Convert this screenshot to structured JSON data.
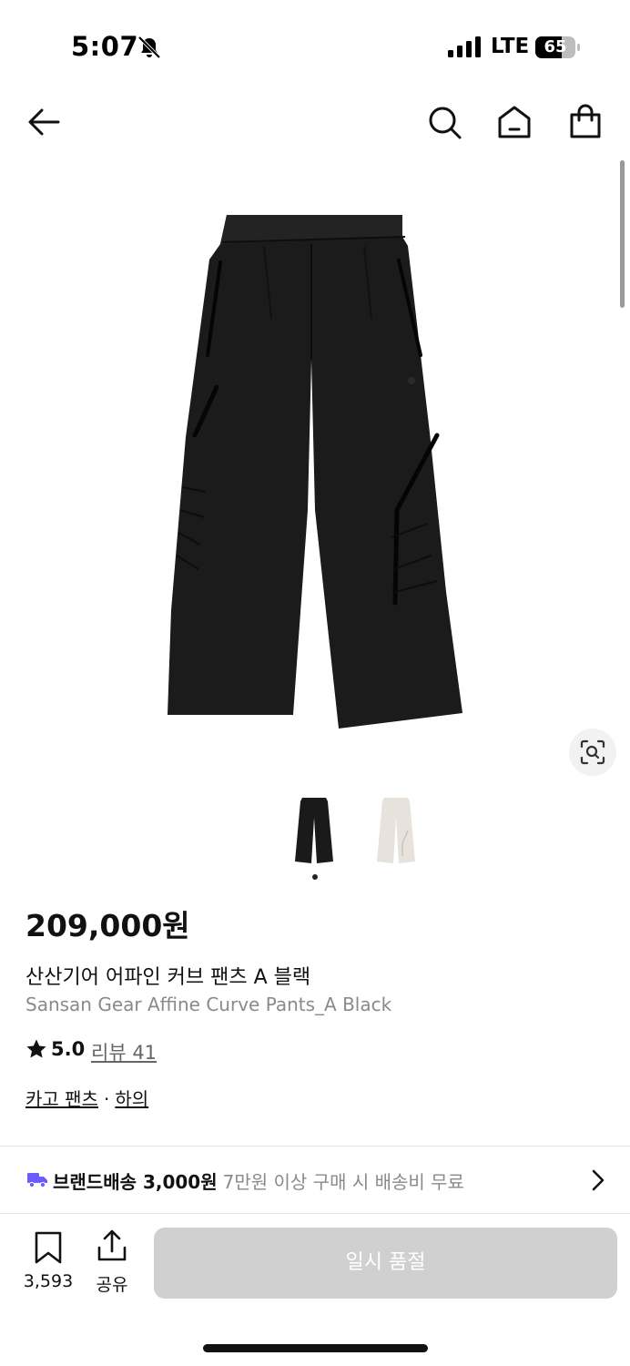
{
  "status_bar": {
    "time": "5:07",
    "network": "LTE",
    "battery": "65"
  },
  "product": {
    "price": "209,000원",
    "name_ko": "산산기어 어파인 커브 팬츠 A 블랙",
    "name_en": "Sansan Gear Affine Curve Pants_A Black",
    "rating": "5.0",
    "review_label": "리뷰 41",
    "categories": [
      "카고 팬츠",
      "하의"
    ],
    "category_separator": "·"
  },
  "thumbnails": [
    {
      "color": "#1a1a1a"
    },
    {
      "color": "#e7e3dc"
    }
  ],
  "shipping": {
    "main": "브랜드배송 3,000원",
    "sub": "7만원 이상 구매 시 배송비 무료",
    "icon_color": "#6b5cff"
  },
  "bottom_bar": {
    "bookmark_count": "3,593",
    "share_label": "공유",
    "cta_label": "일시 품절"
  }
}
